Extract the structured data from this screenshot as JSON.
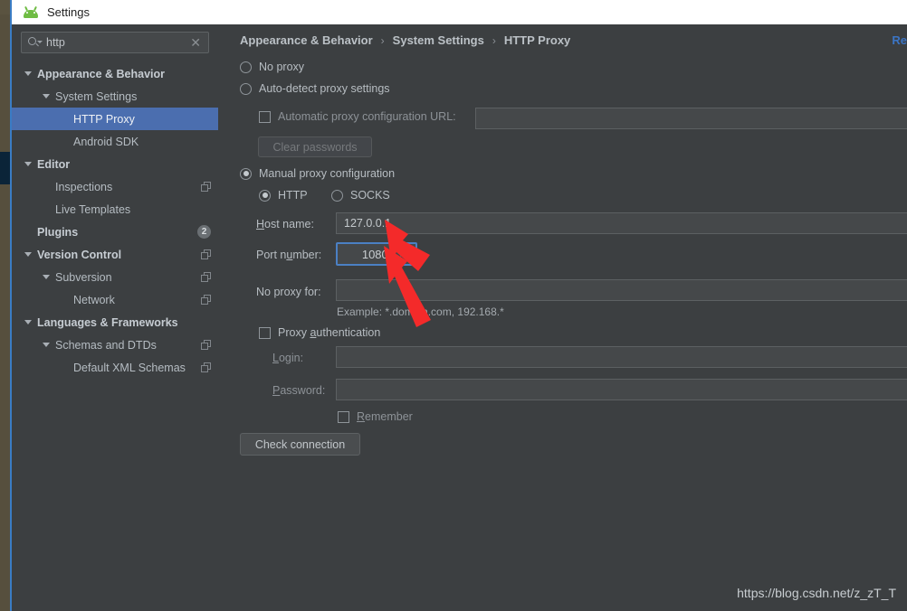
{
  "window": {
    "title": "Settings",
    "app_icon": "android-icon"
  },
  "search": {
    "value": "http",
    "placeholder": "",
    "icon": "search-icon",
    "clear_icon": "close-icon"
  },
  "sidebar": {
    "items": [
      {
        "label": "Appearance & Behavior",
        "indent": 0,
        "arrow": true,
        "bold": true,
        "selected": false,
        "copy": false,
        "badge": ""
      },
      {
        "label": "System Settings",
        "indent": 1,
        "arrow": true,
        "bold": false,
        "selected": false,
        "copy": false,
        "badge": ""
      },
      {
        "label": "HTTP Proxy",
        "indent": 2,
        "arrow": false,
        "bold": false,
        "selected": true,
        "copy": false,
        "badge": ""
      },
      {
        "label": "Android SDK",
        "indent": 2,
        "arrow": false,
        "bold": false,
        "selected": false,
        "copy": false,
        "badge": ""
      },
      {
        "label": "Editor",
        "indent": 0,
        "arrow": true,
        "bold": true,
        "selected": false,
        "copy": false,
        "badge": ""
      },
      {
        "label": "Inspections",
        "indent": 1,
        "arrow": false,
        "bold": false,
        "selected": false,
        "copy": true,
        "badge": ""
      },
      {
        "label": "Live Templates",
        "indent": 1,
        "arrow": false,
        "bold": false,
        "selected": false,
        "copy": false,
        "badge": ""
      },
      {
        "label": "Plugins",
        "indent": 0,
        "arrow": false,
        "bold": true,
        "selected": false,
        "copy": false,
        "badge": "2"
      },
      {
        "label": "Version Control",
        "indent": 0,
        "arrow": true,
        "bold": true,
        "selected": false,
        "copy": true,
        "badge": ""
      },
      {
        "label": "Subversion",
        "indent": 1,
        "arrow": true,
        "bold": false,
        "selected": false,
        "copy": true,
        "badge": ""
      },
      {
        "label": "Network",
        "indent": 2,
        "arrow": false,
        "bold": false,
        "selected": false,
        "copy": true,
        "badge": ""
      },
      {
        "label": "Languages & Frameworks",
        "indent": 0,
        "arrow": true,
        "bold": true,
        "selected": false,
        "copy": false,
        "badge": ""
      },
      {
        "label": "Schemas and DTDs",
        "indent": 1,
        "arrow": true,
        "bold": false,
        "selected": false,
        "copy": true,
        "badge": ""
      },
      {
        "label": "Default XML Schemas",
        "indent": 2,
        "arrow": false,
        "bold": false,
        "selected": false,
        "copy": true,
        "badge": ""
      }
    ]
  },
  "breadcrumb": {
    "crumb1": "Appearance & Behavior",
    "crumb2": "System Settings",
    "crumb3": "HTTP Proxy",
    "separator": "›"
  },
  "reset": {
    "label": "Re"
  },
  "proxy": {
    "no_proxy_label": "No proxy",
    "auto_detect_label": "Auto-detect proxy settings",
    "pac_checkbox_label": "Automatic proxy configuration URL:",
    "pac_value": "",
    "clear_passwords_label": "Clear passwords",
    "manual_label": "Manual proxy configuration",
    "http_label": "HTTP",
    "socks_label": "SOCKS",
    "host_label": "Host name:",
    "host_value": "127.0.0.1",
    "port_label": "Port number:",
    "port_value": "10809",
    "no_proxy_for_label": "No proxy for:",
    "no_proxy_for_value": "",
    "example_hint": "Example: *.domain.com, 192.168.*",
    "auth_checkbox_label": "Proxy authentication",
    "login_label": "Login:",
    "login_value": "",
    "password_label": "Password:",
    "password_value": "",
    "remember_label": "Remember",
    "check_connection_label": "Check connection"
  },
  "watermark": {
    "text": "https://blog.csdn.net/z_zT_T"
  },
  "colors": {
    "accent": "#4b6eaf",
    "focus": "#4b80c4",
    "link": "#3b74c4",
    "arrow_red": "#f42a2a",
    "panel_bg": "#3c3f41",
    "field_bg": "#45484a"
  }
}
